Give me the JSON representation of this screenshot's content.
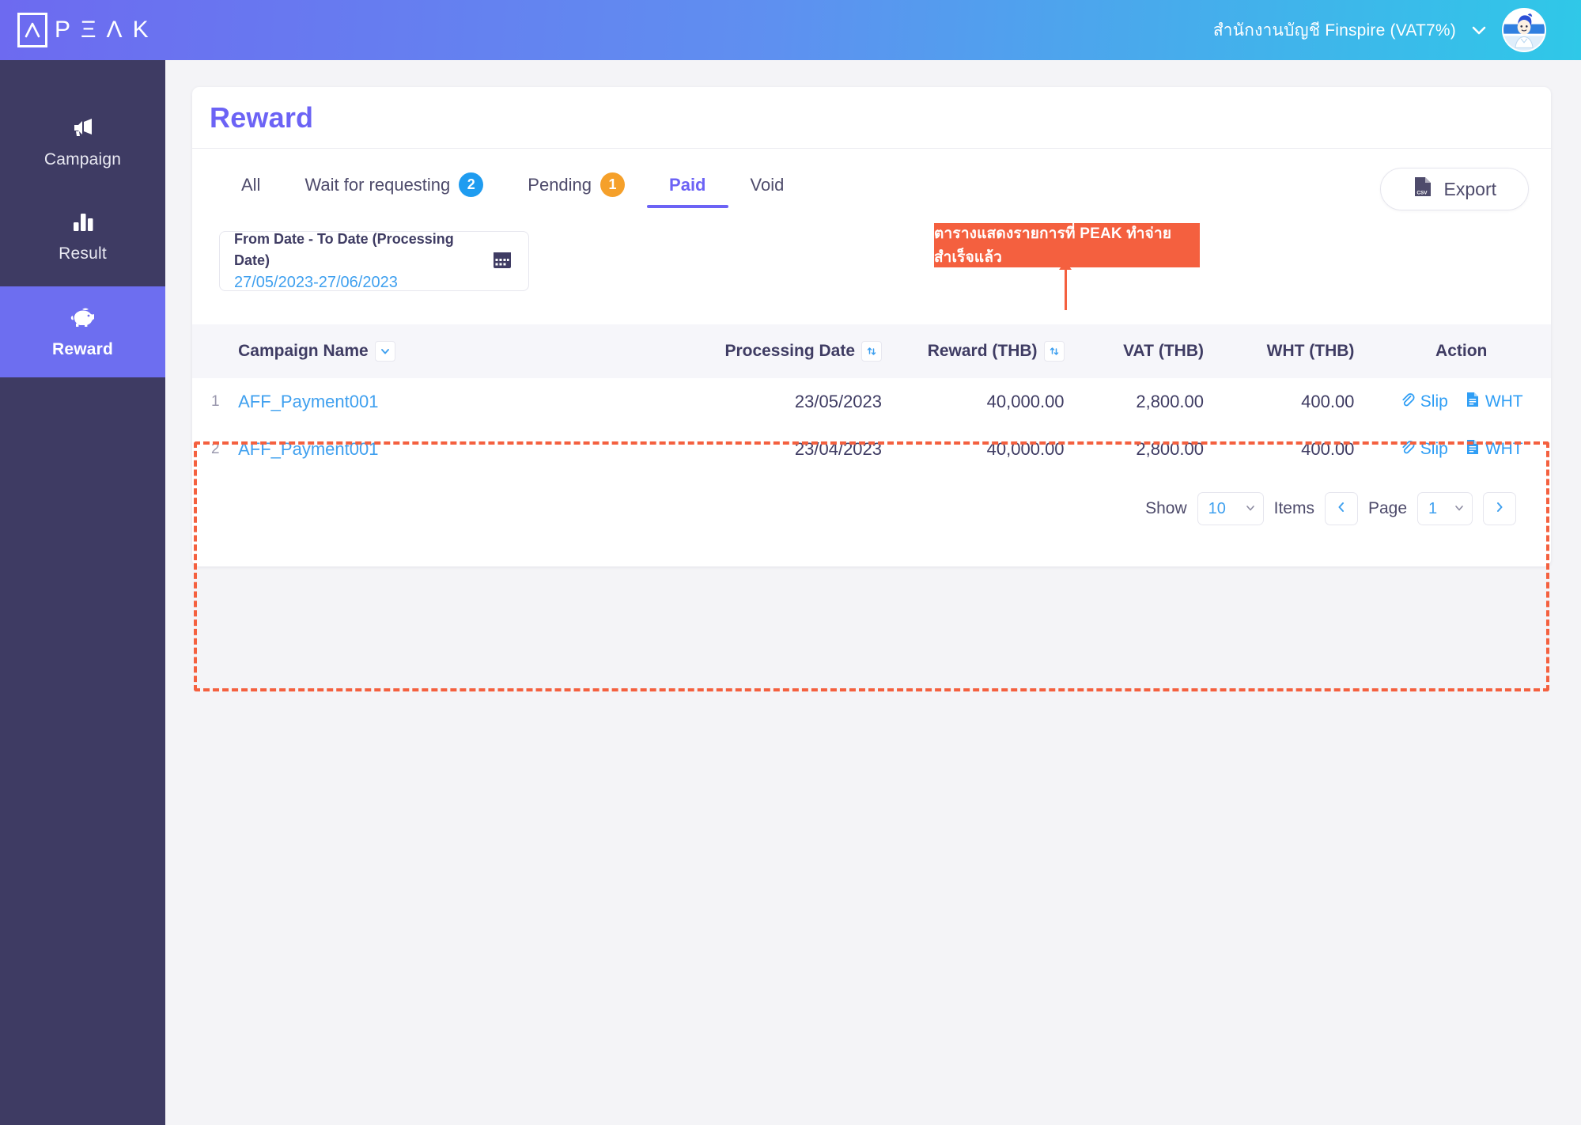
{
  "header": {
    "logo_mark": "peak-logo-icon",
    "logo_letters": [
      "P",
      "Ξ",
      "Λ",
      "K"
    ],
    "account_name": "สำนักงานบัญชี Finspire (VAT7%)",
    "chevron": "chevron-down-icon",
    "avatar": "user-avatar"
  },
  "sidebar": {
    "items": [
      {
        "label": "Campaign",
        "icon": "megaphone-icon",
        "active": false
      },
      {
        "label": "Result",
        "icon": "bar-chart-icon",
        "active": false
      },
      {
        "label": "Reward",
        "icon": "piggy-bank-icon",
        "active": true
      }
    ]
  },
  "page": {
    "title": "Reward"
  },
  "tabs": [
    {
      "label": "All",
      "badge": null,
      "badge_color": null,
      "active": false
    },
    {
      "label": "Wait for requesting",
      "badge": "2",
      "badge_color": "#1f9cf0",
      "active": false
    },
    {
      "label": "Pending",
      "badge": "1",
      "badge_color": "#f5a02a",
      "active": false
    },
    {
      "label": "Paid",
      "badge": null,
      "badge_color": null,
      "active": true
    },
    {
      "label": "Void",
      "badge": null,
      "badge_color": null,
      "active": false
    }
  ],
  "toolbar": {
    "export_label": "Export",
    "export_icon": "csv-file-icon"
  },
  "filter": {
    "date_label": "From Date - To Date (Processing Date)",
    "date_value": "27/05/2023-27/06/2023",
    "calendar_icon": "calendar-icon"
  },
  "annotation": {
    "text": "ตารางแสดงรายการที่ PEAK ทำจ่ายสำเร็จแล้ว",
    "color": "#f4603f"
  },
  "table": {
    "columns": [
      {
        "key": "idx",
        "label": ""
      },
      {
        "key": "name",
        "label": "Campaign Name",
        "control": "chevron-down-icon"
      },
      {
        "key": "date",
        "label": "Processing Date",
        "control": "sort-icon"
      },
      {
        "key": "rew",
        "label": "Reward (THB)",
        "control": "sort-icon"
      },
      {
        "key": "vat",
        "label": "VAT (THB)",
        "control": null
      },
      {
        "key": "wht",
        "label": "WHT (THB)",
        "control": null
      },
      {
        "key": "act",
        "label": "Action",
        "control": null
      }
    ],
    "rows": [
      {
        "idx": "1",
        "name": "AFF_Payment001",
        "date": "23/05/2023",
        "reward": "40,000.00",
        "vat": "2,800.00",
        "wht": "400.00",
        "slip_label": "Slip",
        "wht_label": "WHT"
      },
      {
        "idx": "2",
        "name": "AFF_Payment001",
        "date": "23/04/2023",
        "reward": "40,000.00",
        "vat": "2,800.00",
        "wht": "400.00",
        "slip_label": "Slip",
        "wht_label": "WHT"
      }
    ]
  },
  "pagination": {
    "show_label": "Show",
    "page_size": "10",
    "items_label": "Items",
    "prev_icon": "chevron-left-icon",
    "page_label": "Page",
    "page_number": "1",
    "next_icon": "chevron-right-icon"
  }
}
